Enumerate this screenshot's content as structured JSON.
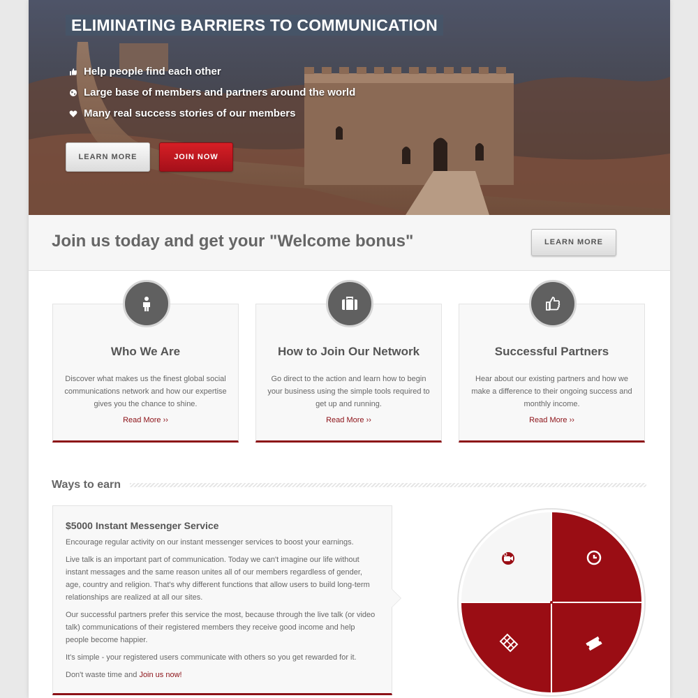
{
  "hero": {
    "title": "ELIMINATING BARRIERS TO COMMUNICATION",
    "bullets": [
      {
        "icon": "thumbs-up-icon",
        "text": "Help people find each other"
      },
      {
        "icon": "globe-icon",
        "text": "Large base of members and partners around the world"
      },
      {
        "icon": "heart-icon",
        "text": "Many real success stories of our members"
      }
    ],
    "learn_more_label": "LEARN MORE",
    "join_now_label": "JOIN NOW"
  },
  "cta": {
    "text": "Join us today and get your \"Welcome bonus\"",
    "button_label": "LEARN MORE"
  },
  "features": [
    {
      "icon": "person-icon",
      "title": "Who We Are",
      "text": "Discover what makes us the finest global social communications network and how our expertise gives you the chance to shine.",
      "link": "Read More ››"
    },
    {
      "icon": "briefcase-icon",
      "title": "How to Join Our Network",
      "text": "Go direct to the action and learn how to begin your business using the simple tools required to get up and running.",
      "link": "Read More ››"
    },
    {
      "icon": "thumbs-up-icon",
      "title": "Successful Partners",
      "text": "Hear about our existing partners and how we make a difference to their ongoing success and monthly income.",
      "link": "Read More ››"
    }
  ],
  "earn": {
    "section_title": "Ways to earn",
    "title": "$5000 Instant Messenger Service",
    "paragraphs": [
      "Encourage regular activity on our instant messenger services to boost your earnings.",
      "Live talk is an important part of communication. Today we can't imagine our life without instant messages and the same reason unites all of our members regardless of gender, age, country and religion. That's why different functions that allow users to build long-term relationships are realized at all our sites.",
      "Our successful partners prefer this service the most, because through the live talk (or video talk) communications of their registered members they receive good income and help people become happier.",
      "It's simple - your registered users communicate with others so you get rewarded for it."
    ],
    "last_prefix": "Don't waste time and ",
    "last_link": "Join us now!"
  },
  "wheel": {
    "segments": [
      {
        "icon": "video-camera-icon",
        "active": true
      },
      {
        "icon": "clock-icon",
        "active": false
      },
      {
        "icon": "film-icon",
        "active": false
      },
      {
        "icon": "ticket-icon",
        "active": false
      }
    ],
    "colors": {
      "accent": "#9a0d14",
      "inactive_bg": "#f6f6f6"
    }
  },
  "colors": {
    "brand": "#8c1117",
    "button_red": "#c4171e"
  }
}
